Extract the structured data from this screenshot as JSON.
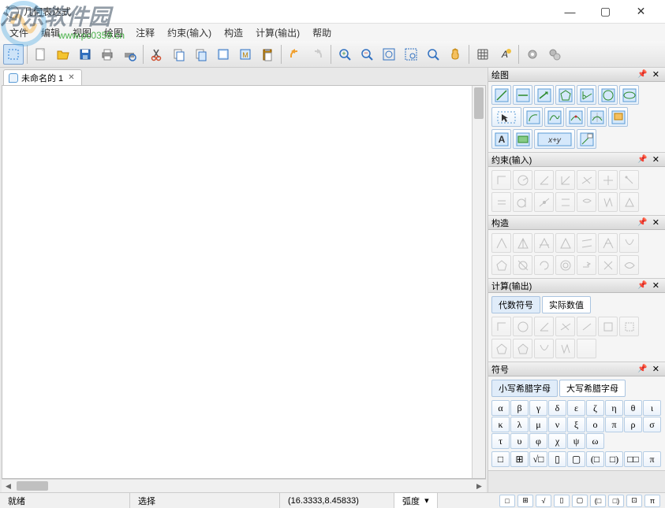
{
  "title": "几何表达式",
  "watermark": "河东软件园",
  "watermark_url": "www.pc0359.cn",
  "menus": [
    "文件",
    "编辑",
    "视图",
    "绘图",
    "注释",
    "约束(输入)",
    "构造",
    "计算(输出)",
    "帮助"
  ],
  "tab": {
    "label": "未命名的 1"
  },
  "panels": {
    "draw": {
      "title": "绘图"
    },
    "constraint": {
      "title": "约束(输入)"
    },
    "construct": {
      "title": "构造"
    },
    "calc": {
      "title": "计算(输出)",
      "tabs": [
        "代数符号",
        "实际数值"
      ]
    },
    "symbol": {
      "title": "符号",
      "tabs": [
        "小写希腊字母",
        "大写希腊字母"
      ]
    }
  },
  "greek_lower": [
    "α",
    "β",
    "γ",
    "δ",
    "ε",
    "ζ",
    "η",
    "θ",
    "ι",
    "κ",
    "λ",
    "μ",
    "ν",
    "ξ",
    "ο",
    "π",
    "ρ",
    "σ",
    "τ",
    "υ",
    "φ",
    "χ",
    "ψ",
    "ω"
  ],
  "math_syms": [
    "□",
    "⊞",
    "√□",
    "▯",
    "▢",
    "(□",
    "□)",
    "□□",
    "π"
  ],
  "status": {
    "ready": "就绪",
    "select": "选择",
    "coords": "(16.3333,8.45833)",
    "unit": "弧度"
  }
}
